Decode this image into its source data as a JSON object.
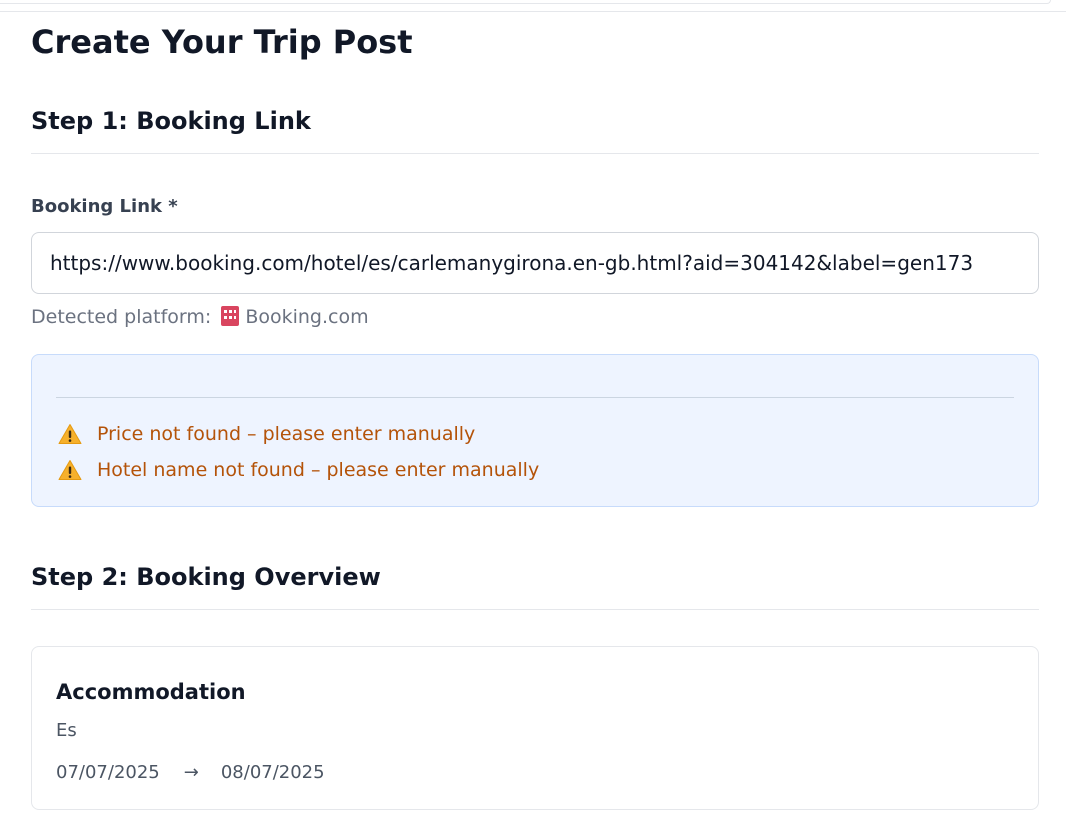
{
  "page": {
    "title": "Create Your Trip Post"
  },
  "step1": {
    "heading": "Step 1: Booking Link",
    "field_label": "Booking Link *",
    "url_value": "https://www.booking.com/hotel/es/carlemanygirona.en-gb.html?aid=304142&label=gen173",
    "detected_prefix": "Detected platform:",
    "detected_icon": "hotel-icon",
    "detected_platform": "Booking.com",
    "warnings": [
      {
        "icon": "warning-icon",
        "text": "Price not found – please enter manually"
      },
      {
        "icon": "warning-icon",
        "text": "Hotel name not found – please enter manually"
      }
    ]
  },
  "step2": {
    "heading": "Step 2: Booking Overview",
    "card": {
      "title": "Accommodation",
      "location": "Es",
      "check_in": "07/07/2025",
      "arrow": "→",
      "check_out": "08/07/2025"
    }
  },
  "colors": {
    "warning_text": "#b45309",
    "notice_bg": "#eef4ff",
    "notice_border": "#c7dbfb"
  }
}
